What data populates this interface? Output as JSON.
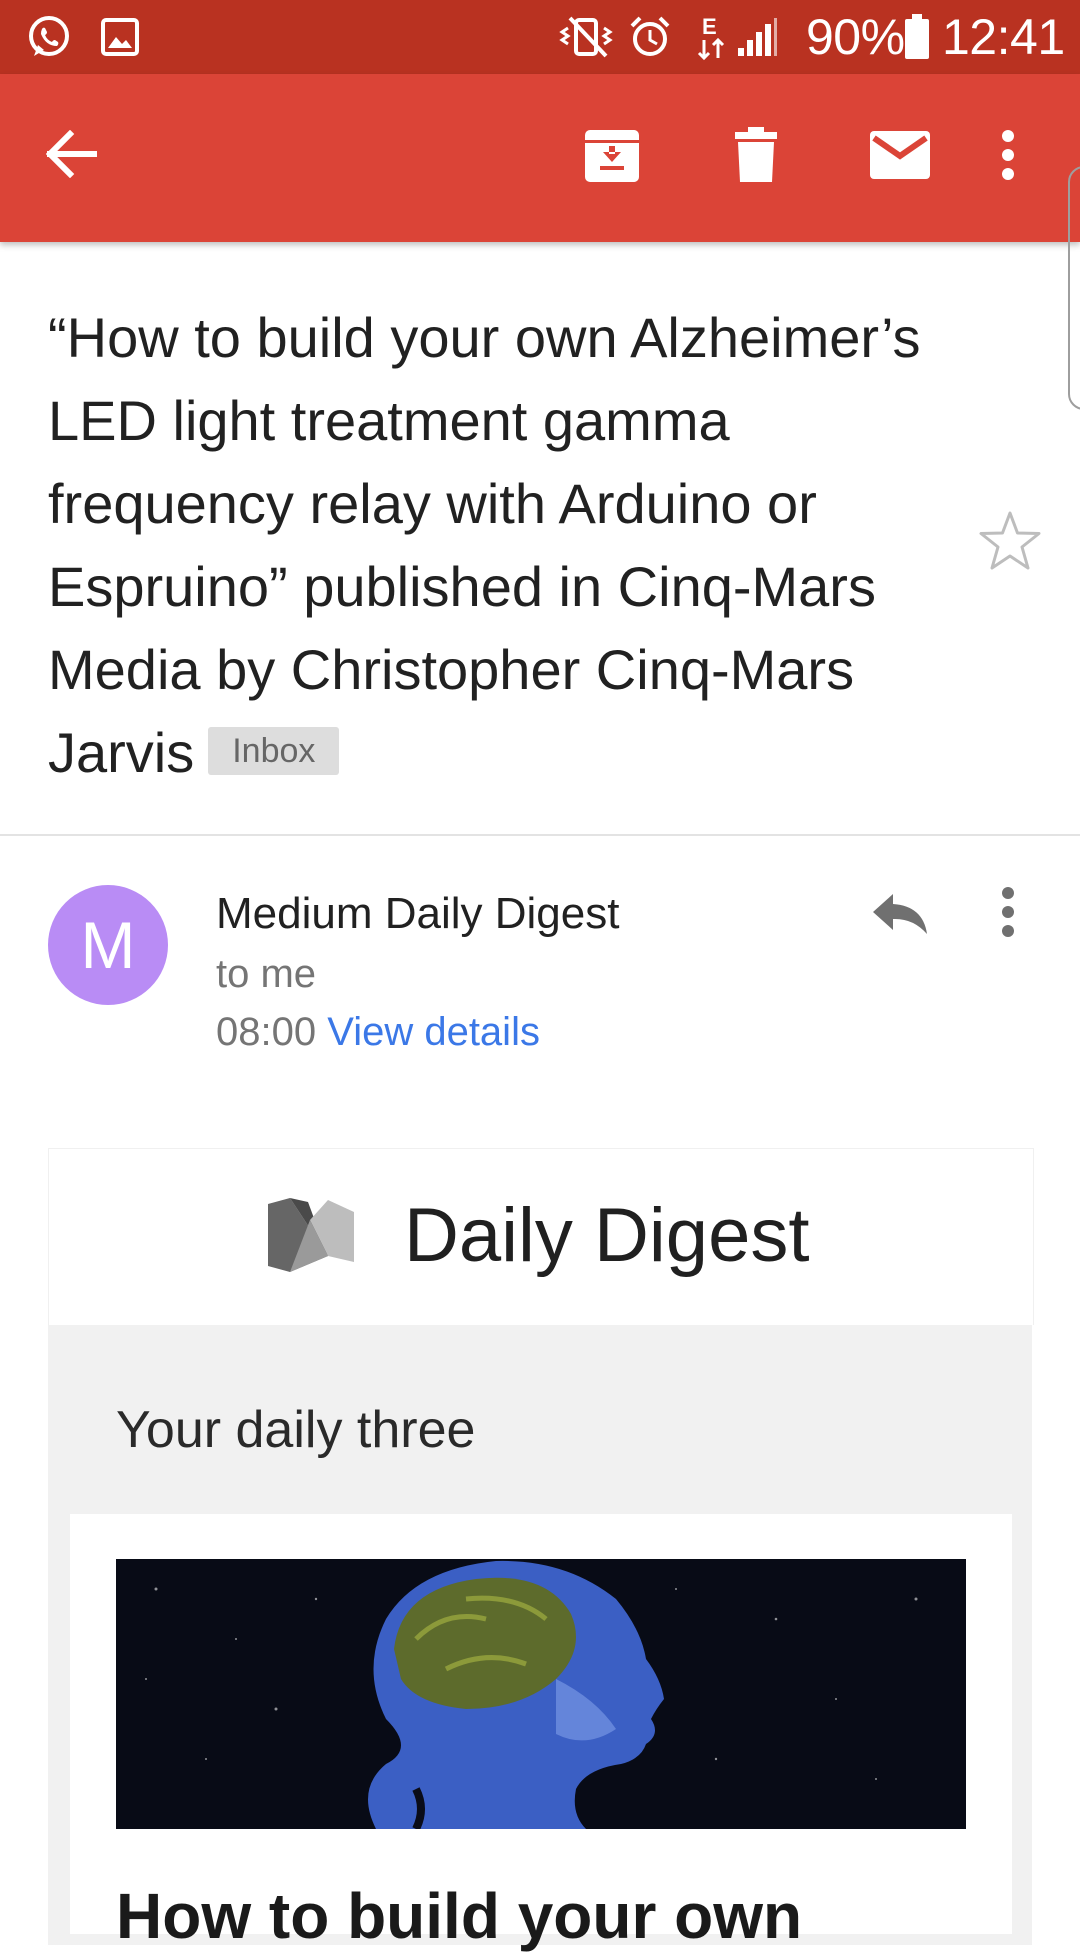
{
  "status_bar": {
    "battery": "90%",
    "time": "12:41",
    "network": "E",
    "icons": [
      "whatsapp-icon",
      "gallery-icon",
      "vibrate-mute-icon",
      "alarm-icon",
      "network-data-icon",
      "signal-icon",
      "battery-icon"
    ]
  },
  "toolbar": {
    "icons": [
      "back-arrow-icon",
      "archive-icon",
      "delete-icon",
      "mark-unread-icon",
      "overflow-menu-icon"
    ]
  },
  "email": {
    "subject": "“How to build your own Alzheimer’s LED light treatment gamma frequency relay with Arduino or Espruino” published in Cinq-Mars Media by Christopher Cinq-Mars Jarvis",
    "label": "Inbox",
    "sender": {
      "initial": "M",
      "name": "Medium Daily Digest",
      "recipient": "to me",
      "time": "08:00",
      "details_link": "View details",
      "avatar_color": "#b98cf5"
    }
  },
  "body": {
    "header_title": "Daily Digest",
    "section_title": "Your daily three",
    "story_title": "How to build your own"
  },
  "colors": {
    "status_bar": "#b93221",
    "app_bar": "#db4437",
    "link": "#3b78e7"
  }
}
